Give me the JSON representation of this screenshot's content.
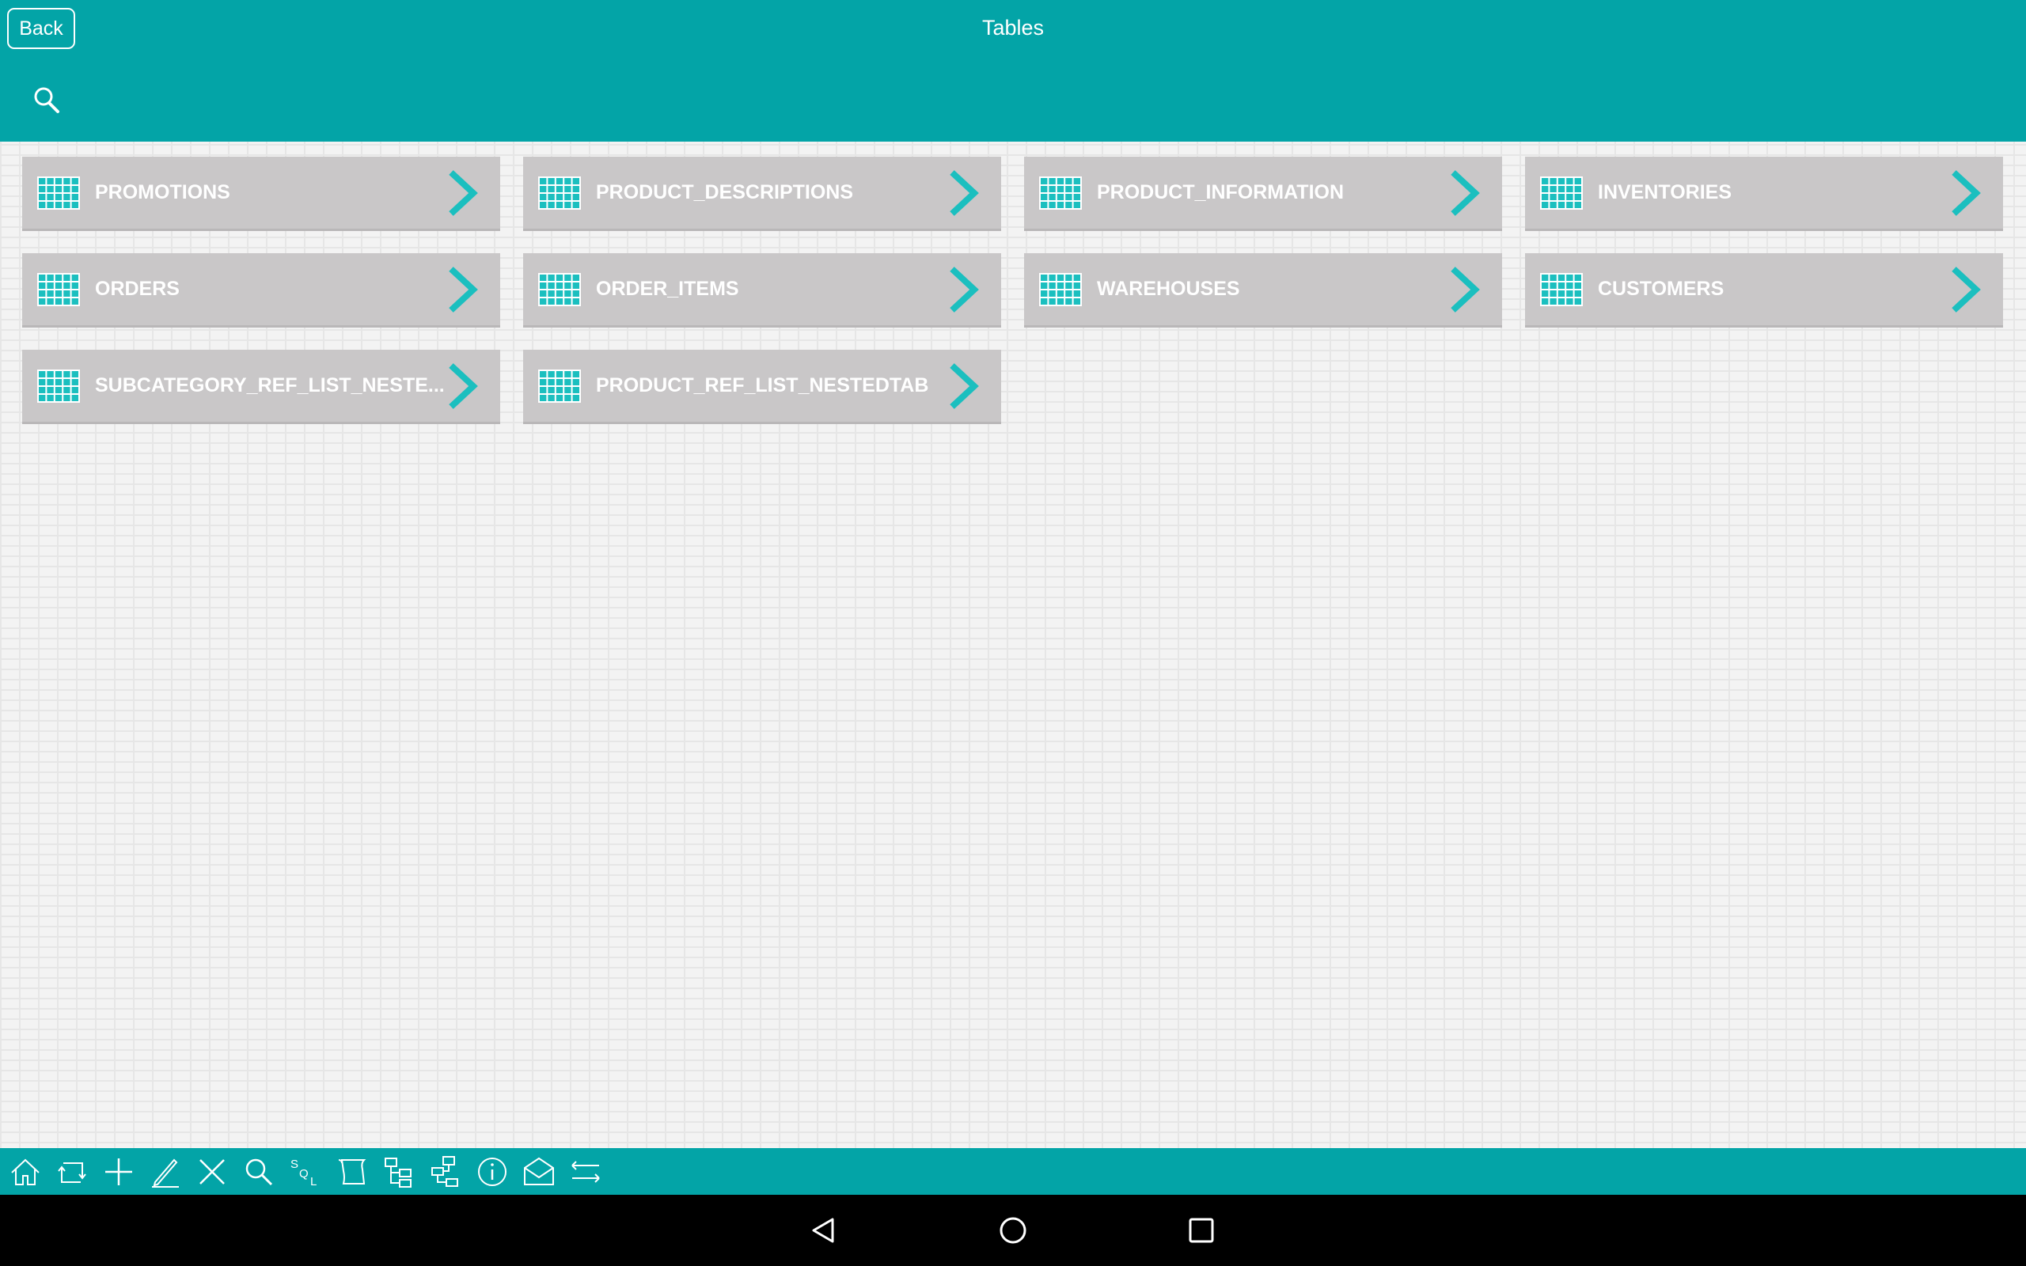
{
  "header": {
    "title": "Tables",
    "back_label": "Back",
    "background": "#03a4a7"
  },
  "tables": [
    {
      "name": "PROMOTIONS"
    },
    {
      "name": "PRODUCT_DESCRIPTIONS"
    },
    {
      "name": "PRODUCT_INFORMATION"
    },
    {
      "name": "INVENTORIES"
    },
    {
      "name": "ORDERS"
    },
    {
      "name": "ORDER_ITEMS"
    },
    {
      "name": "WAREHOUSES"
    },
    {
      "name": "CUSTOMERS"
    },
    {
      "name": "SUBCATEGORY_REF_LIST_NESTE..."
    },
    {
      "name": "PRODUCT_REF_LIST_NESTEDTAB"
    }
  ],
  "toolbar": {
    "icons": [
      "home-icon",
      "refresh-icon",
      "add-icon",
      "edit-icon",
      "delete-icon",
      "search-icon",
      "sql-icon",
      "script-icon",
      "hierarchy-icon",
      "hierarchy-alt-icon",
      "info-icon",
      "mail-icon",
      "swap-icon"
    ],
    "sql_text": [
      "S",
      "Q",
      "L"
    ]
  },
  "colors": {
    "accent": "#03a4a7",
    "tile": "#c9c7c8",
    "icon": "#1bbfbf"
  }
}
